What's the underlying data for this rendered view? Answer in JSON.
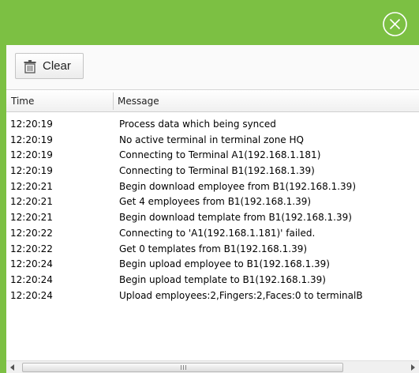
{
  "toolbar": {
    "clear_label": "Clear"
  },
  "grid": {
    "columns": {
      "time": "Time",
      "message": "Message"
    },
    "rows": [
      {
        "time": "12:20:19",
        "message": "Process data which being synced"
      },
      {
        "time": "12:20:19",
        "message": "No active terminal in terminal zone HQ"
      },
      {
        "time": "12:20:19",
        "message": "Connecting to Terminal A1(192.168.1.181)"
      },
      {
        "time": "12:20:19",
        "message": "Connecting to Terminal B1(192.168.1.39)"
      },
      {
        "time": "12:20:21",
        "message": "Begin download employee from B1(192.168.1.39)"
      },
      {
        "time": "12:20:21",
        "message": "Get 4 employees from B1(192.168.1.39)"
      },
      {
        "time": "12:20:21",
        "message": "Begin download template from B1(192.168.1.39)"
      },
      {
        "time": "12:20:22",
        "message": "Connecting to 'A1(192.168.1.181)' failed."
      },
      {
        "time": "12:20:22",
        "message": "Get 0 templates from B1(192.168.1.39)"
      },
      {
        "time": "12:20:24",
        "message": "Begin upload employee to B1(192.168.1.39)"
      },
      {
        "time": "12:20:24",
        "message": "Begin upload template to B1(192.168.1.39)"
      },
      {
        "time": "12:20:24",
        "message": "Upload employees:2,Fingers:2,Faces:0 to terminalB"
      }
    ]
  },
  "scrollbar": {
    "grip": "III"
  },
  "colors": {
    "accent": "#7cc043"
  },
  "icons": {
    "close": "close-circle-icon",
    "clear": "trash-icon",
    "scroll_left": "arrow-left-icon",
    "scroll_right": "arrow-right-icon"
  }
}
